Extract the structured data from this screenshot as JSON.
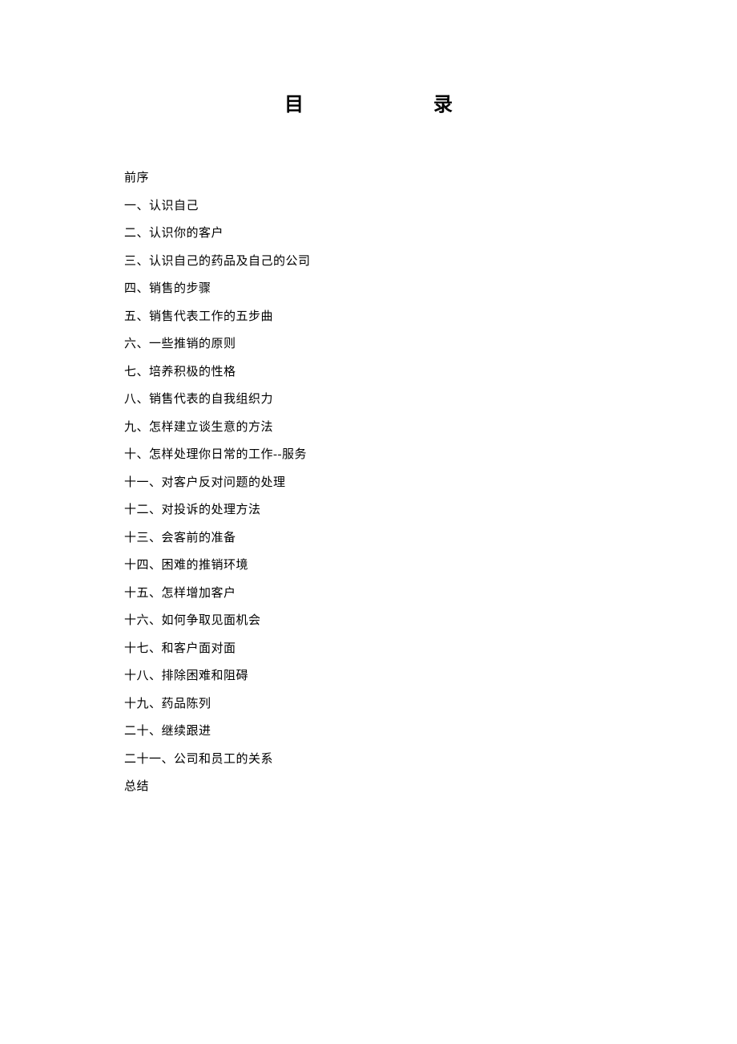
{
  "title": {
    "char1": "目",
    "char2": "录"
  },
  "toc": [
    "前序",
    "一、认识自己",
    "二、认识你的客户",
    "三、认识自己的药品及自己的公司",
    "四、销售的步骤",
    "五、销售代表工作的五步曲",
    "六、一些推销的原则",
    "七、培养积极的性格",
    "八、销售代表的自我组织力",
    "九、怎样建立谈生意的方法",
    "十、怎样处理你日常的工作--服务",
    "十一、对客户反对问题的处理",
    "十二、对投诉的处理方法",
    "十三、会客前的准备",
    "十四、困难的推销环境",
    "十五、怎样增加客户",
    "十六、如何争取见面机会",
    "十七、和客户面对面",
    "十八、排除困难和阻碍",
    "十九、药品陈列",
    "二十、继续跟进",
    "二十一、公司和员工的关系",
    "总结"
  ]
}
